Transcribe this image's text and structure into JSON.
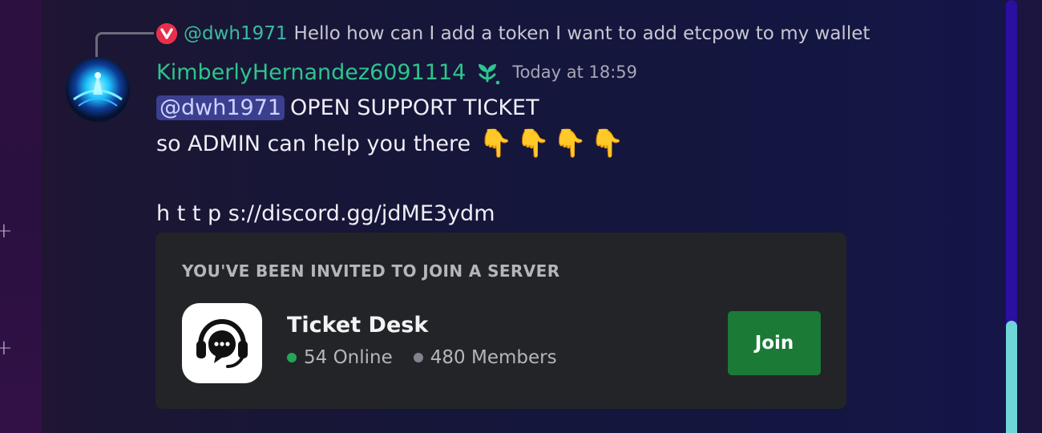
{
  "rail": {
    "icons": [
      "plus-icon",
      "plus-icon"
    ]
  },
  "reply": {
    "mention": "@dwh1971",
    "text": "Hello how can I add a token I want to add etcpow to my wallet",
    "avatar_icon": "vivaldi-icon",
    "avatar_color": "#e8304a"
  },
  "message": {
    "username": "KimberlyHernandez6091114",
    "username_color": "#2ec48d",
    "badge_icon": "sprout-icon",
    "timestamp": "Today at 18:59",
    "mention": "@dwh1971",
    "line1": "OPEN SUPPORT TICKET",
    "line2": "so ADMIN can help you there",
    "emojis": [
      "👇",
      "👇",
      "👇",
      "👇"
    ],
    "link": "h t t p s://discord.gg/jdME3ydm"
  },
  "invite": {
    "heading": "YOU'VE BEEN INVITED TO JOIN A SERVER",
    "server_name": "Ticket Desk",
    "server_icon": "headset-chat-icon",
    "online": "54 Online",
    "members": "480 Members",
    "online_color": "#23a55a",
    "members_color": "#80848e",
    "join_label": "Join",
    "join_color": "#1a7a36"
  }
}
